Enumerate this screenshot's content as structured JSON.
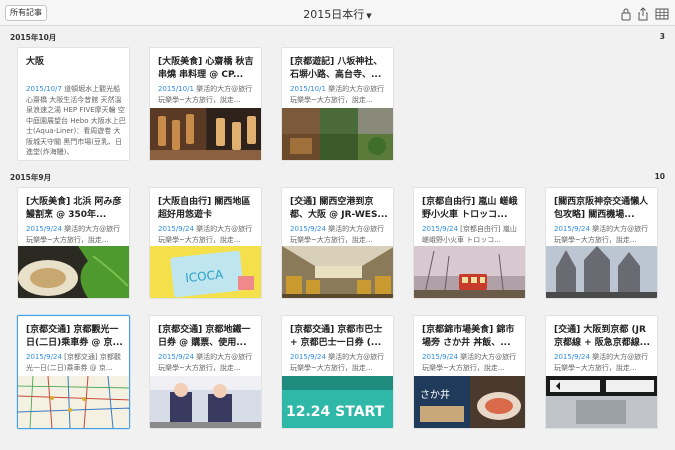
{
  "toolbar": {
    "all_notes_label": "所有記事",
    "notebook_title": "2015日本行",
    "icons": [
      "lock-icon",
      "share-icon",
      "grid-view-icon"
    ]
  },
  "sections": [
    {
      "label": "2015年10月",
      "count": "3",
      "cards": [
        {
          "title": "大阪",
          "date": "2015/10/7",
          "snippet": " 道頓堀水上觀光船 心齋橋 大阪生活今昔館 天然溫泉浪速之湯 HEP FIVE摩天輪 空中庭園展望台 Hebo 大阪水上巴士(Aqua-Liner)：看周遊卷 大阪城天守閣 黑門市場(豆乳、日進堂(炸海鰻)、"
        },
        {
          "title": "[大阪美食] 心齋橋 秋吉串燒 串料理 @ CP...",
          "date": "2015/10/1",
          "snippet": " 樂活的大方@旅行玩樂學~大方旅行，說走..."
        },
        {
          "title": "[京都遊記] 八坂神社、石塀小路、高台寺、...",
          "date": "2015/10/1",
          "snippet": " 樂活的大方@旅行玩樂學~大方旅行，說走..."
        }
      ]
    },
    {
      "label": "2015年9月",
      "count": "10",
      "cards": [
        {
          "title": "[大阪美食] 北浜 阿み彦 鰻割烹 @ 350年...",
          "date": "2015/9/24",
          "snippet": " 樂活的大方@旅行玩樂學~大方旅行，說走..."
        },
        {
          "title": "[大阪自由行] 關西地區超好用悠遊卡 ICOCA...",
          "date": "2015/9/24",
          "snippet": " 樂活的大方@旅行玩樂學~大方旅行，說走..."
        },
        {
          "title": "[交通] 關西空港到京都、大阪 @ JR-WES...",
          "date": "2015/9/24",
          "snippet": " 樂活的大方@旅行玩樂學~大方旅行，說走..."
        },
        {
          "title": "[京都自由行] 嵐山 嵯峨野小火車 トロッコ...",
          "date": "2015/9/24",
          "snippet": " [京都自由行] 嵐山 嵯峨野小火車 トロッコ..."
        },
        {
          "title": "[關西京阪神奈交通懶人包攻略] 關西機場...",
          "date": "2015/9/24",
          "snippet": " 樂活的大方@旅行玩樂學~大方旅行，說走..."
        },
        {
          "title": "[京都交通] 京都觀光一日(二日)乘車券 @ 京...",
          "date": "2015/9/24",
          "snippet": " [京都交通] 京都觀光一日(二日)乘車券 @ 京..."
        },
        {
          "title": "[京都交通] 京都地鐵一日券 @ 購票、使用...",
          "date": "2015/9/24",
          "snippet": " 樂活的大方@旅行玩樂學~大方旅行，說走..."
        },
        {
          "title": "[京都交通] 京都市巴士 + 京都巴士一日券 (...",
          "date": "2015/9/24",
          "snippet": " 樂活的大方@旅行玩樂學~大方旅行，說走..."
        },
        {
          "title": "[京都錦市場美食] 錦市場旁 さか井 丼飯、...",
          "date": "2015/9/24",
          "snippet": " 樂活的大方@旅行玩樂學~大方旅行，說走..."
        },
        {
          "title": "[交通] 大阪到京都 (JR京都線 + 阪急京都線...",
          "date": "2015/9/24",
          "snippet": " 樂活的大方@旅行玩樂學~大方旅行，說走..."
        }
      ]
    }
  ],
  "thumb_text": {
    "icoca": "ICOCA",
    "start_sign": "12.24 START",
    "sakai_sign": "さか井"
  }
}
